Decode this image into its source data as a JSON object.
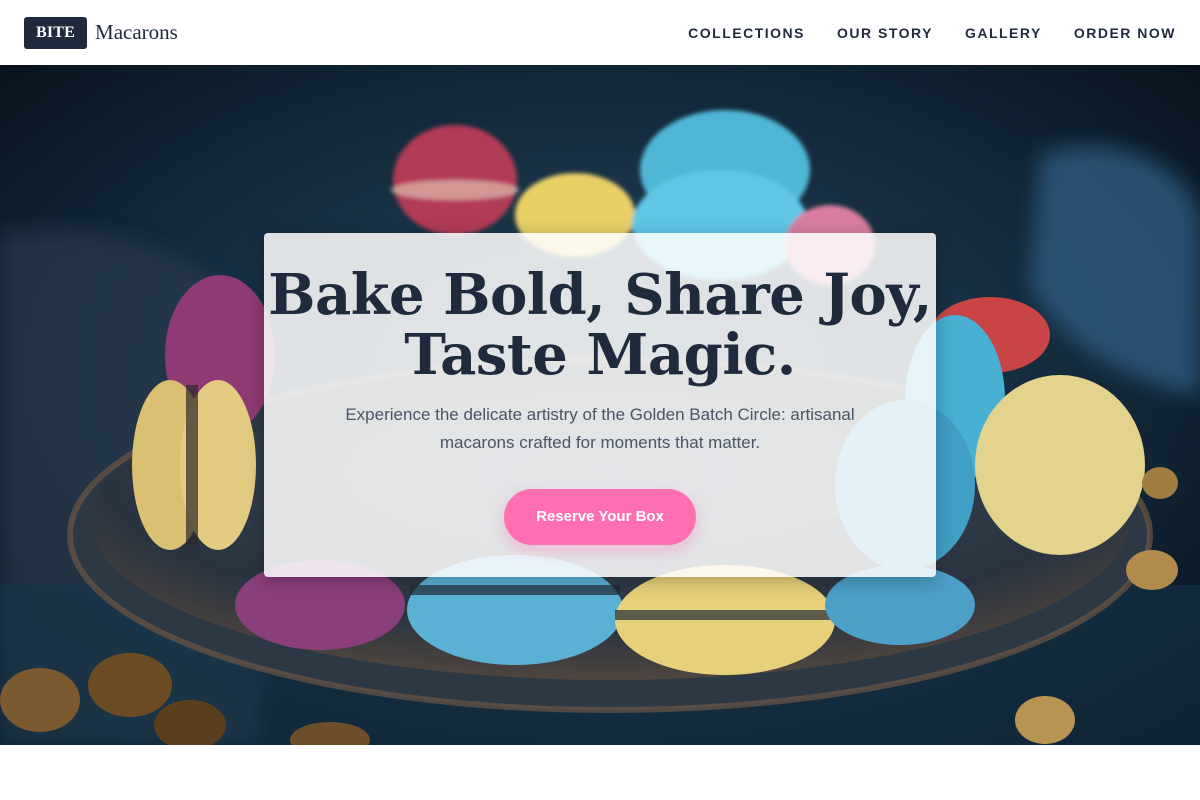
{
  "brand": {
    "badge": "BITE",
    "name": "Macarons"
  },
  "nav": {
    "items": [
      {
        "label": "COLLECTIONS"
      },
      {
        "label": "OUR STORY"
      },
      {
        "label": "GALLERY"
      },
      {
        "label": "ORDER NOW"
      }
    ]
  },
  "hero": {
    "title_line1": "Bake Bold, Share Joy,",
    "title_line2": "Taste Magic.",
    "subtitle": "Experience the delicate artistry of the Golden Batch Circle: artisanal macarons crafted for moments that matter.",
    "cta_label": "Reserve Your Box"
  },
  "colors": {
    "brand_navy": "#1f2a3d",
    "accent_pink": "#ff6fb2",
    "hero_bg_dark": "#0b1a26"
  }
}
